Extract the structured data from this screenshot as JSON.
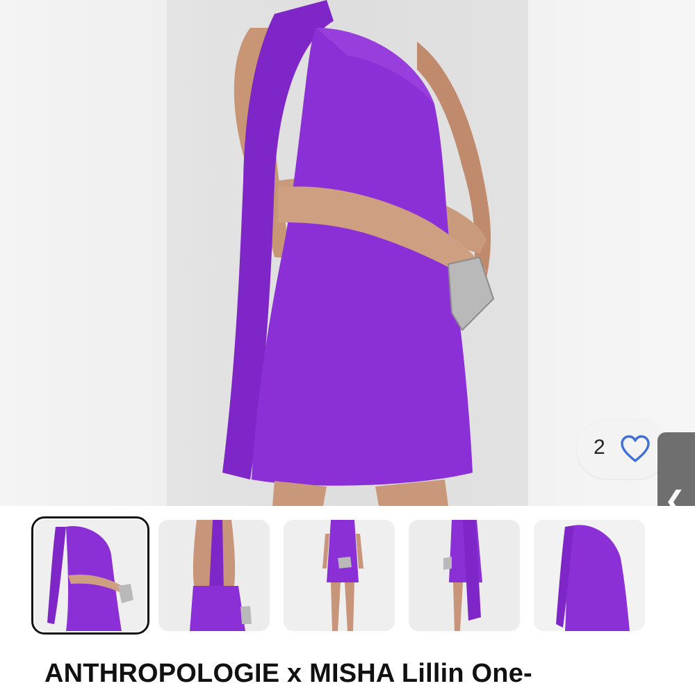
{
  "product": {
    "title": "ANTHROPOLOGIE x MISHA Lillin One-",
    "dress_color": "#8b2fd6"
  },
  "likes": {
    "count": "2",
    "icon": "heart-outline-icon",
    "icon_color": "#3f6fd8"
  },
  "gallery": {
    "collapse_icon": "chevron-left-icon",
    "collapse_glyph": "❮",
    "thumbnails": [
      {
        "view": "front-cropped",
        "selected": true
      },
      {
        "view": "back"
      },
      {
        "view": "front-full"
      },
      {
        "view": "back-full"
      },
      {
        "view": "detail"
      }
    ]
  }
}
